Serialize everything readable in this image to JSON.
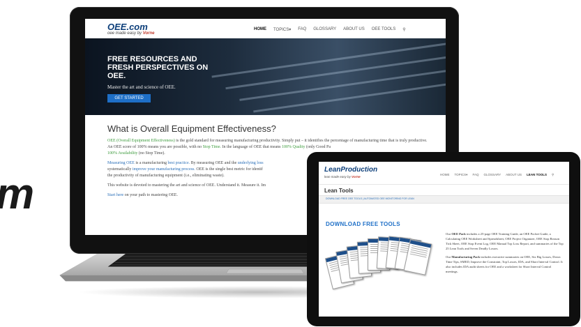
{
  "edge_text": "m",
  "laptop_site": {
    "logo": "OEE.com",
    "tagline": "oee made easy by",
    "tagline_brand": "Vorne",
    "nav": [
      "HOME",
      "TOPICS▾",
      "FAQ",
      "GLOSSARY",
      "ABOUT US",
      "OEE TOOLS",
      "⚲"
    ],
    "hero_title": "FREE RESOURCES AND FRESH PERSPECTIVES ON OEE.",
    "hero_subtitle": "Master the art and science of OEE.",
    "hero_button": "GET STARTED",
    "heading": "What is Overall Equipment Effectiveness?",
    "p1_link": "OEE (Overall Equipment Effectiveness)",
    "p1_a": "is the gold standard for measuring manufacturing productivity. Simply put – it identifies the percentage of manufacturing time that is truly productive. An OEE score of 100% means you are",
    "p1_b": "possible, with no",
    "p1_stop": "Stop Time.",
    "p1_c": "In the language of OEE that means",
    "p1_quality": "100% Quality",
    "p1_d": "(only Good Pa",
    "p1_avail": "100% Availability",
    "p1_e": "(no Stop Time).",
    "p2_link1": "Measuring OEE",
    "p2_a": "is a manufacturing",
    "p2_link2": "best practice.",
    "p2_b": "By measuring OEE and the",
    "p2_link3": "underlying loss",
    "p2_c": "systematically",
    "p2_link4": "improve your manufacturing process.",
    "p2_d": "OEE is the single best metric for identif",
    "p2_e": "the productivity of manufacturing equipment (i.e., eliminating waste).",
    "p3": "This website is devoted to mastering the art and science of OEE. Understand it. Measure it. Im",
    "p4_link": "Start here",
    "p4": "on your path to mastering OEE."
  },
  "tablet_site": {
    "logo": "LeanProduction",
    "tagline": "lean made easy by",
    "tagline_brand": "Vorne",
    "nav": [
      "HOME",
      "TOPICS▾",
      "FAQ",
      "GLOSSARY",
      "ABOUT US",
      "LEAN TOOLS",
      "⚲"
    ],
    "page_title": "Lean Tools",
    "breadcrumb": "DOWNLOAD FREE OEE TOOLS  |  AUTOMATED OEE MONITORING FOR LEAN",
    "section_heading": "DOWNLOAD FREE TOOLS",
    "p1_a": "Our",
    "p1_bold": "OEE Pack",
    "p1_b": "includes a 25-page OEE Training Guide, an OEE Pocket Guide, a Calculating OEE Worksheet and Spreadsheet, OEE Project Organizer, OEE Stop Reason Tick Sheet, OEE Stop Event Log, OEE Manual Top Loss Report, and summaries of the Top 25 Lean Tools and Seven Deadly Losses.",
    "p2_a": "Our",
    "p2_bold": "Manufacturing Pack",
    "p2_b": "includes executive summaries on OEE, Six Big Losses, Down Time Tips, SMED, Improve the Constraint, Top Losses, IDA, and Short Interval Control. It also includes IDA audit sheets for OEE and a worksheet for Short Interval Control meetings."
  }
}
